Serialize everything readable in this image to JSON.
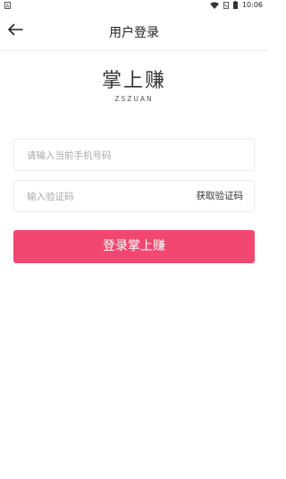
{
  "status_bar": {
    "time": "10:06",
    "left_icon": "notification-a-icon",
    "icons": [
      "wifi-icon",
      "sim-icon",
      "battery-icon"
    ]
  },
  "header": {
    "back_icon": "arrow-left-icon",
    "title": "用户登录"
  },
  "logo": {
    "name": "掌上赚",
    "subtitle": "ZSZUAN"
  },
  "form": {
    "phone_placeholder": "请输入当前手机号码",
    "code_placeholder": "输入验证码",
    "get_code_label": "获取验证码",
    "login_label": "登录掌上赚"
  },
  "colors": {
    "accent": "#f24770",
    "background": "#ffffff"
  }
}
